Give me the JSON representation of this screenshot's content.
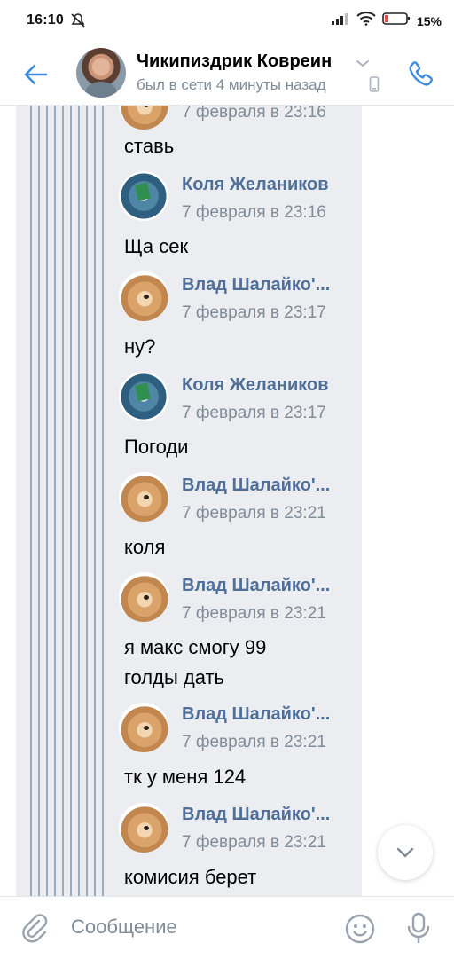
{
  "status_bar": {
    "time": "16:10",
    "battery": "15%",
    "icons": [
      "mute-icon",
      "signal-icon",
      "wifi-icon",
      "battery-icon"
    ]
  },
  "header": {
    "name": "Чикипиздрик Ковреин",
    "status": "был в сети 4 минуты назад",
    "icons": [
      "back-arrow-icon",
      "chevron-down-icon",
      "phone-device-icon",
      "call-icon"
    ],
    "accent": "#3f8ae0"
  },
  "chat": {
    "partial_date": "7 февраля в 23:16",
    "messages": [
      {
        "text": "ставь"
      },
      {
        "sender": "Коля Желаников",
        "date": "7 февраля в 23:16",
        "avatar": "globe",
        "lines": [
          "Ща сек"
        ]
      },
      {
        "sender": "Влад Шалайко'...",
        "date": "7 февраля в 23:17",
        "avatar": "doge",
        "lines": [
          "ну?"
        ]
      },
      {
        "sender": "Коля Желаников",
        "date": "7 февраля в 23:17",
        "avatar": "globe",
        "lines": [
          "Погоди"
        ]
      },
      {
        "sender": "Влад Шалайко'...",
        "date": "7 февраля в 23:21",
        "avatar": "doge",
        "lines": [
          "коля"
        ]
      },
      {
        "sender": "Влад Шалайко'...",
        "date": "7 февраля в 23:21",
        "avatar": "doge",
        "lines": [
          "я макс смогу 99",
          "голды дать"
        ]
      },
      {
        "sender": "Влад Шалайко'...",
        "date": "7 февраля в 23:21",
        "avatar": "doge",
        "lines": [
          "тк у меня 124"
        ]
      },
      {
        "sender": "Влад Шалайко'...",
        "date": "7 февраля в 23:21",
        "avatar": "doge",
        "lines": [
          "комисия берет"
        ]
      }
    ]
  },
  "composer": {
    "placeholder": "Сообщение",
    "icons": [
      "attach-icon",
      "emoji-icon",
      "microphone-icon"
    ]
  },
  "colors": {
    "sender": "#4f6f99",
    "muted": "#818c99",
    "forward_bg": "#ebedf0",
    "stripes": "#9aabc4"
  }
}
